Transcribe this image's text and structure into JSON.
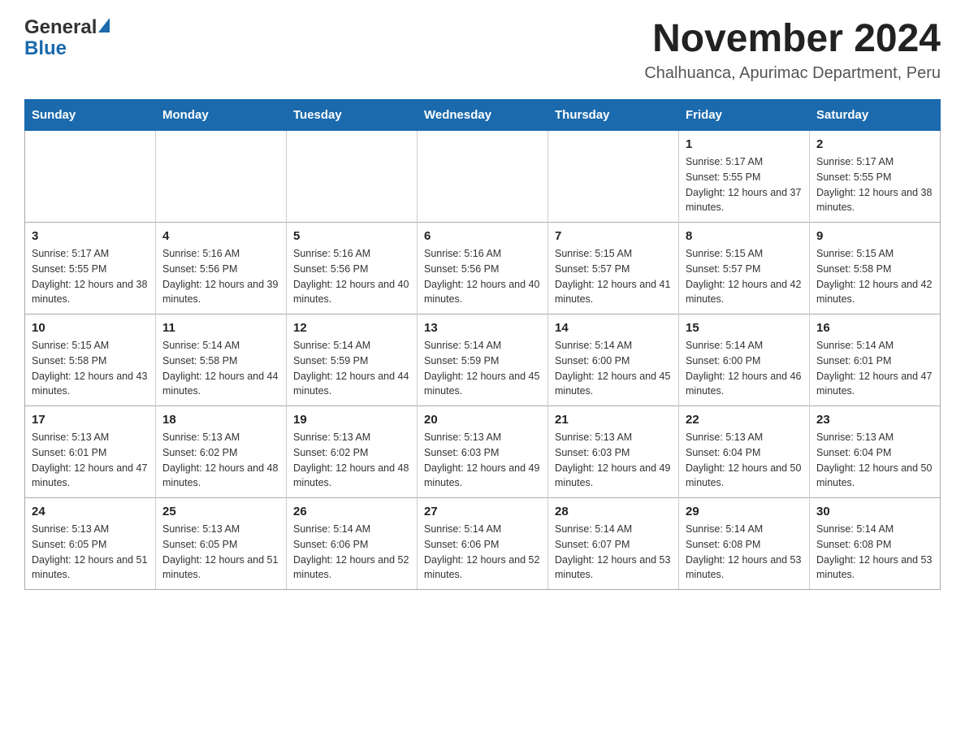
{
  "logo": {
    "general": "General",
    "blue": "Blue",
    "triangle": "▶"
  },
  "title": "November 2024",
  "subtitle": "Chalhuanca, Apurimac Department, Peru",
  "days_header": [
    "Sunday",
    "Monday",
    "Tuesday",
    "Wednesday",
    "Thursday",
    "Friday",
    "Saturday"
  ],
  "weeks": [
    [
      {
        "day": "",
        "sunrise": "",
        "sunset": "",
        "daylight": ""
      },
      {
        "day": "",
        "sunrise": "",
        "sunset": "",
        "daylight": ""
      },
      {
        "day": "",
        "sunrise": "",
        "sunset": "",
        "daylight": ""
      },
      {
        "day": "",
        "sunrise": "",
        "sunset": "",
        "daylight": ""
      },
      {
        "day": "",
        "sunrise": "",
        "sunset": "",
        "daylight": ""
      },
      {
        "day": "1",
        "sunrise": "Sunrise: 5:17 AM",
        "sunset": "Sunset: 5:55 PM",
        "daylight": "Daylight: 12 hours and 37 minutes."
      },
      {
        "day": "2",
        "sunrise": "Sunrise: 5:17 AM",
        "sunset": "Sunset: 5:55 PM",
        "daylight": "Daylight: 12 hours and 38 minutes."
      }
    ],
    [
      {
        "day": "3",
        "sunrise": "Sunrise: 5:17 AM",
        "sunset": "Sunset: 5:55 PM",
        "daylight": "Daylight: 12 hours and 38 minutes."
      },
      {
        "day": "4",
        "sunrise": "Sunrise: 5:16 AM",
        "sunset": "Sunset: 5:56 PM",
        "daylight": "Daylight: 12 hours and 39 minutes."
      },
      {
        "day": "5",
        "sunrise": "Sunrise: 5:16 AM",
        "sunset": "Sunset: 5:56 PM",
        "daylight": "Daylight: 12 hours and 40 minutes."
      },
      {
        "day": "6",
        "sunrise": "Sunrise: 5:16 AM",
        "sunset": "Sunset: 5:56 PM",
        "daylight": "Daylight: 12 hours and 40 minutes."
      },
      {
        "day": "7",
        "sunrise": "Sunrise: 5:15 AM",
        "sunset": "Sunset: 5:57 PM",
        "daylight": "Daylight: 12 hours and 41 minutes."
      },
      {
        "day": "8",
        "sunrise": "Sunrise: 5:15 AM",
        "sunset": "Sunset: 5:57 PM",
        "daylight": "Daylight: 12 hours and 42 minutes."
      },
      {
        "day": "9",
        "sunrise": "Sunrise: 5:15 AM",
        "sunset": "Sunset: 5:58 PM",
        "daylight": "Daylight: 12 hours and 42 minutes."
      }
    ],
    [
      {
        "day": "10",
        "sunrise": "Sunrise: 5:15 AM",
        "sunset": "Sunset: 5:58 PM",
        "daylight": "Daylight: 12 hours and 43 minutes."
      },
      {
        "day": "11",
        "sunrise": "Sunrise: 5:14 AM",
        "sunset": "Sunset: 5:58 PM",
        "daylight": "Daylight: 12 hours and 44 minutes."
      },
      {
        "day": "12",
        "sunrise": "Sunrise: 5:14 AM",
        "sunset": "Sunset: 5:59 PM",
        "daylight": "Daylight: 12 hours and 44 minutes."
      },
      {
        "day": "13",
        "sunrise": "Sunrise: 5:14 AM",
        "sunset": "Sunset: 5:59 PM",
        "daylight": "Daylight: 12 hours and 45 minutes."
      },
      {
        "day": "14",
        "sunrise": "Sunrise: 5:14 AM",
        "sunset": "Sunset: 6:00 PM",
        "daylight": "Daylight: 12 hours and 45 minutes."
      },
      {
        "day": "15",
        "sunrise": "Sunrise: 5:14 AM",
        "sunset": "Sunset: 6:00 PM",
        "daylight": "Daylight: 12 hours and 46 minutes."
      },
      {
        "day": "16",
        "sunrise": "Sunrise: 5:14 AM",
        "sunset": "Sunset: 6:01 PM",
        "daylight": "Daylight: 12 hours and 47 minutes."
      }
    ],
    [
      {
        "day": "17",
        "sunrise": "Sunrise: 5:13 AM",
        "sunset": "Sunset: 6:01 PM",
        "daylight": "Daylight: 12 hours and 47 minutes."
      },
      {
        "day": "18",
        "sunrise": "Sunrise: 5:13 AM",
        "sunset": "Sunset: 6:02 PM",
        "daylight": "Daylight: 12 hours and 48 minutes."
      },
      {
        "day": "19",
        "sunrise": "Sunrise: 5:13 AM",
        "sunset": "Sunset: 6:02 PM",
        "daylight": "Daylight: 12 hours and 48 minutes."
      },
      {
        "day": "20",
        "sunrise": "Sunrise: 5:13 AM",
        "sunset": "Sunset: 6:03 PM",
        "daylight": "Daylight: 12 hours and 49 minutes."
      },
      {
        "day": "21",
        "sunrise": "Sunrise: 5:13 AM",
        "sunset": "Sunset: 6:03 PM",
        "daylight": "Daylight: 12 hours and 49 minutes."
      },
      {
        "day": "22",
        "sunrise": "Sunrise: 5:13 AM",
        "sunset": "Sunset: 6:04 PM",
        "daylight": "Daylight: 12 hours and 50 minutes."
      },
      {
        "day": "23",
        "sunrise": "Sunrise: 5:13 AM",
        "sunset": "Sunset: 6:04 PM",
        "daylight": "Daylight: 12 hours and 50 minutes."
      }
    ],
    [
      {
        "day": "24",
        "sunrise": "Sunrise: 5:13 AM",
        "sunset": "Sunset: 6:05 PM",
        "daylight": "Daylight: 12 hours and 51 minutes."
      },
      {
        "day": "25",
        "sunrise": "Sunrise: 5:13 AM",
        "sunset": "Sunset: 6:05 PM",
        "daylight": "Daylight: 12 hours and 51 minutes."
      },
      {
        "day": "26",
        "sunrise": "Sunrise: 5:14 AM",
        "sunset": "Sunset: 6:06 PM",
        "daylight": "Daylight: 12 hours and 52 minutes."
      },
      {
        "day": "27",
        "sunrise": "Sunrise: 5:14 AM",
        "sunset": "Sunset: 6:06 PM",
        "daylight": "Daylight: 12 hours and 52 minutes."
      },
      {
        "day": "28",
        "sunrise": "Sunrise: 5:14 AM",
        "sunset": "Sunset: 6:07 PM",
        "daylight": "Daylight: 12 hours and 53 minutes."
      },
      {
        "day": "29",
        "sunrise": "Sunrise: 5:14 AM",
        "sunset": "Sunset: 6:08 PM",
        "daylight": "Daylight: 12 hours and 53 minutes."
      },
      {
        "day": "30",
        "sunrise": "Sunrise: 5:14 AM",
        "sunset": "Sunset: 6:08 PM",
        "daylight": "Daylight: 12 hours and 53 minutes."
      }
    ]
  ]
}
